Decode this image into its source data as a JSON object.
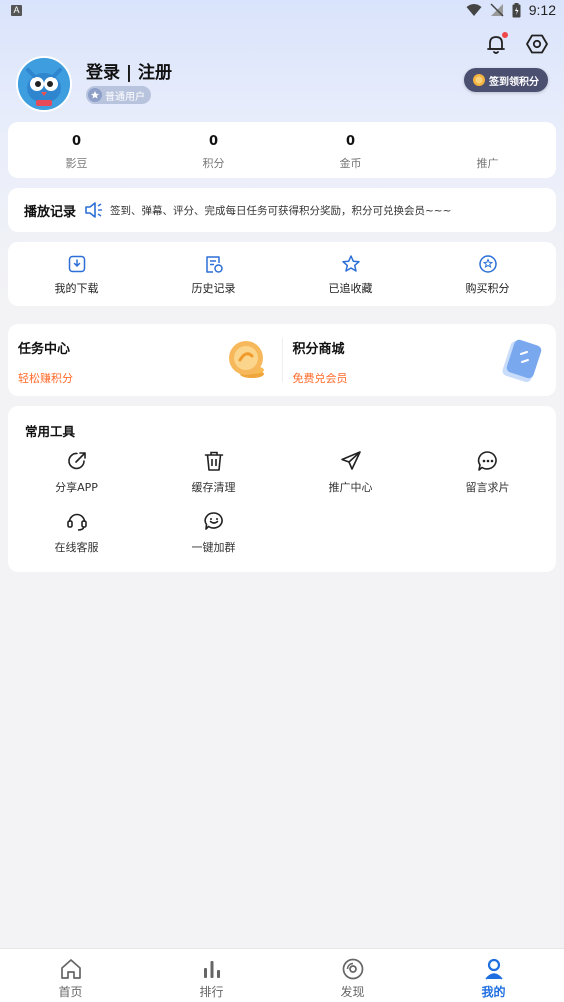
{
  "status_bar": {
    "time": "9:12"
  },
  "profile": {
    "login_label": "登录 | 注册",
    "user_level": "普通用户",
    "signin_label": "签到领积分"
  },
  "stats": [
    {
      "value": "0",
      "label": "影豆"
    },
    {
      "value": "0",
      "label": "积分"
    },
    {
      "value": "0",
      "label": "金币"
    },
    {
      "value": "",
      "label": "推广"
    }
  ],
  "playback": {
    "title": "播放记录",
    "notice": "签到、弹幕、评分、完成每日任务可获得积分奖励，积分可兑换会员~~~"
  },
  "quick_actions": [
    {
      "label": "我的下载",
      "icon": "download-icon"
    },
    {
      "label": "历史记录",
      "icon": "history-icon"
    },
    {
      "label": "已追收藏",
      "icon": "star-icon"
    },
    {
      "label": "购买积分",
      "icon": "points-icon"
    }
  ],
  "tasks": [
    {
      "title": "任务中心",
      "subtitle": "轻松赚积分",
      "icon": "coin-icon"
    },
    {
      "title": "积分商城",
      "subtitle": "免费兑会员",
      "icon": "card-icon"
    }
  ],
  "tools": {
    "heading": "常用工具",
    "items": [
      {
        "label": "分享APP",
        "icon": "share-icon"
      },
      {
        "label": "缓存清理",
        "icon": "trash-icon"
      },
      {
        "label": "推广中心",
        "icon": "send-icon"
      },
      {
        "label": "留言求片",
        "icon": "chat-icon"
      },
      {
        "label": "在线客服",
        "icon": "headset-icon"
      },
      {
        "label": "一键加群",
        "icon": "group-chat-icon"
      }
    ]
  },
  "bottom_nav": [
    {
      "label": "首页",
      "icon": "home-icon"
    },
    {
      "label": "排行",
      "icon": "ranking-icon"
    },
    {
      "label": "发现",
      "icon": "discover-icon"
    },
    {
      "label": "我的",
      "icon": "profile-icon",
      "active": true
    }
  ],
  "colors": {
    "accent": "#1f6fe0",
    "orange": "#ff6a2a",
    "signin_bg": "#4b4f70"
  }
}
